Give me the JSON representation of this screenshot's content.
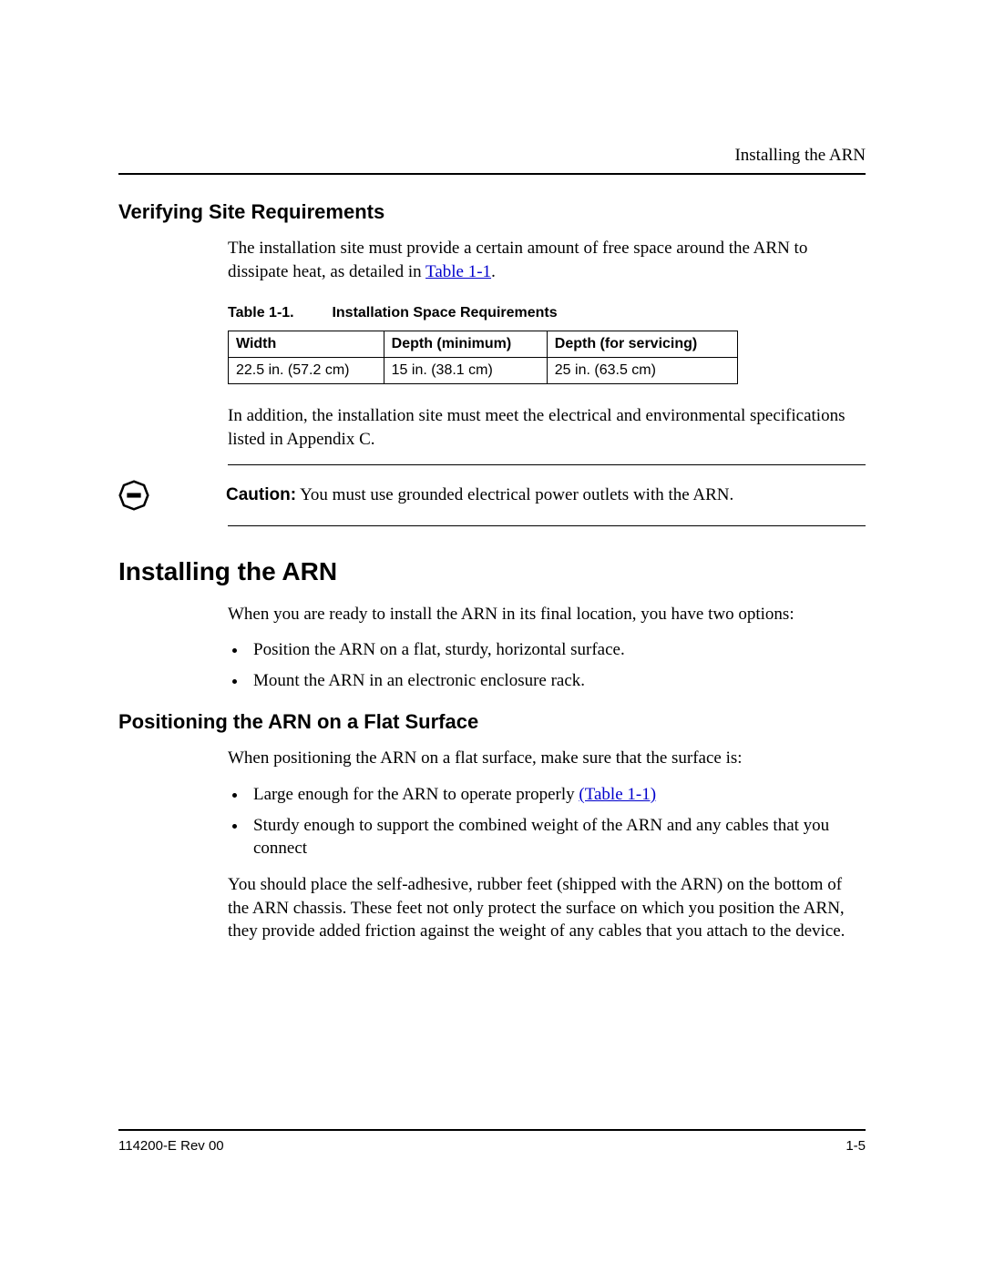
{
  "header": {
    "running_title": "Installing the ARN"
  },
  "section1": {
    "heading": "Verifying Site Requirements",
    "para1_a": "The installation site must provide a certain amount of free space around the ARN to dissipate heat, as detailed in ",
    "para1_link": "Table 1-1",
    "para1_b": ".",
    "table_label": "Table 1-1.",
    "table_title": "Installation Space Requirements",
    "table": {
      "headers": [
        "Width",
        "Depth (minimum)",
        "Depth (for servicing)"
      ],
      "row": [
        "22.5 in. (57.2 cm)",
        "15 in. (38.1 cm)",
        "25 in. (63.5 cm)"
      ]
    },
    "para2": "In addition, the installation site must meet the electrical and environmental specifications listed in Appendix C."
  },
  "caution": {
    "label": "Caution:",
    "text": " You must use grounded electrical power outlets with the ARN."
  },
  "section2": {
    "heading": "Installing the ARN",
    "intro": "When you are ready to install the ARN in its final location, you have two options:",
    "bullets": [
      "Position the ARN on a flat, sturdy, horizontal surface.",
      "Mount the ARN in an electronic enclosure rack."
    ]
  },
  "section3": {
    "heading": "Positioning the ARN on a Flat Surface",
    "intro": "When positioning the ARN on a flat surface, make sure that the surface is:",
    "bullet1_a": "Large enough for the ARN to operate properly ",
    "bullet1_link": "(Table 1-1)",
    "bullet2": "Sturdy enough to support the combined weight of the ARN and any cables that you connect",
    "para": "You should place the self-adhesive, rubber feet (shipped with the ARN) on the bottom of the ARN chassis. These feet not only protect the surface on which you position the ARN, they provide added friction against the weight of any cables that you attach to the device."
  },
  "footer": {
    "left": "114200-E Rev 00",
    "right": "1-5"
  }
}
